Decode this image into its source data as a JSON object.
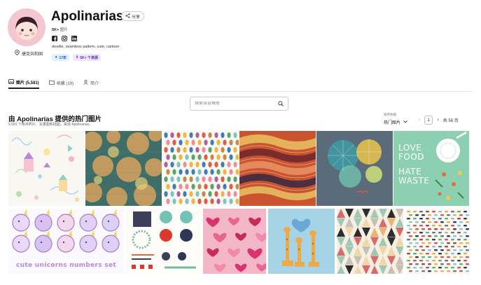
{
  "profile": {
    "name": "Apolinarias",
    "share_label": "分享",
    "followers_count": "5K+",
    "followers_label": "图片",
    "location": "捷克共和国",
    "tags": "doodle, seamless pattern, cute, cartoon",
    "rank_badge": "17年",
    "resources_badge": "5K+ 个资源"
  },
  "tabs": [
    {
      "label": "图片 (5,581)",
      "icon": "image-icon"
    },
    {
      "label": "收藏 (19)",
      "icon": "folder-icon"
    },
    {
      "label": "简介",
      "icon": "user-icon"
    }
  ],
  "search": {
    "placeholder": "搜索该投稿者"
  },
  "section": {
    "title": "由 Apolinarias 提供的热门图片",
    "subtitle": "5,581 个库存照片、矢量图和插图。来自 Apolinarias。"
  },
  "sort": {
    "label": "排序依据",
    "value": "热门图片"
  },
  "pager": {
    "current": "1",
    "total": "共 56 页"
  },
  "colors": {
    "avatar_bg": "#f4c6cf",
    "rank_badge": "#e3f0ff",
    "resources_badge": "#efe6ff"
  },
  "gallery": [
    {
      "name": "tile-doodle-kids"
    },
    {
      "name": "tile-orange-circles"
    },
    {
      "name": "tile-colorful-dots"
    },
    {
      "name": "tile-tribal-waves"
    },
    {
      "name": "tile-fireworks"
    },
    {
      "name": "tile-love-food-hate-waste"
    },
    {
      "name": "tile-unicorn-numbers"
    },
    {
      "name": "tile-paint-swatches"
    },
    {
      "name": "tile-pink-hearts"
    },
    {
      "name": "tile-giraffes"
    },
    {
      "name": "tile-triangles"
    },
    {
      "name": "tile-dash-pattern"
    }
  ],
  "tile_text": {
    "love_food": "LOVE FOOD",
    "hate_waste": "HATE WASTE",
    "unicorn_caption": "cute unicorns numbers set"
  }
}
